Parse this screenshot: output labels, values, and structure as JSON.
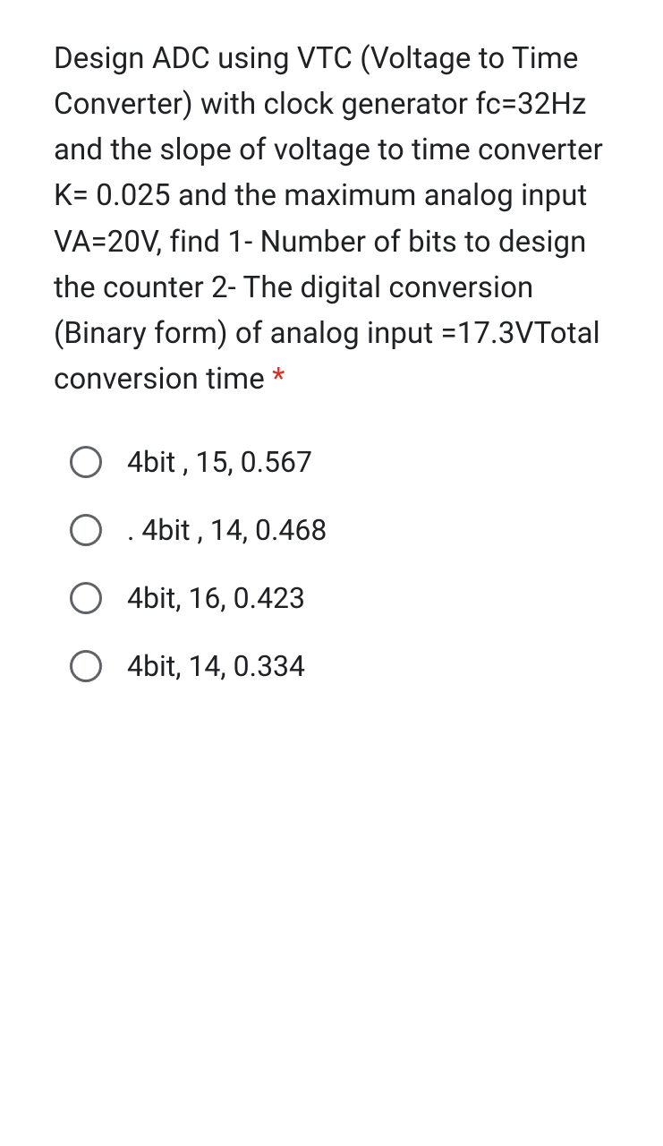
{
  "question": {
    "text": "Design ADC using VTC (Voltage to Time Converter) with clock generator fc=32Hz and the slope of voltage to time converter K= 0.025 and the maximum analog input VA=20V, find 1- Number of bits to design the counter 2- The digital conversion (Binary form) of analog input =17.3VTotal conversion time",
    "required_mark": "*"
  },
  "options": [
    {
      "label": "4bit , 15, 0.567"
    },
    {
      "label": ". 4bit , 14, 0.468"
    },
    {
      "label": "4bit, 16, 0.423"
    },
    {
      "label": "4bit, 14, 0.334"
    }
  ]
}
